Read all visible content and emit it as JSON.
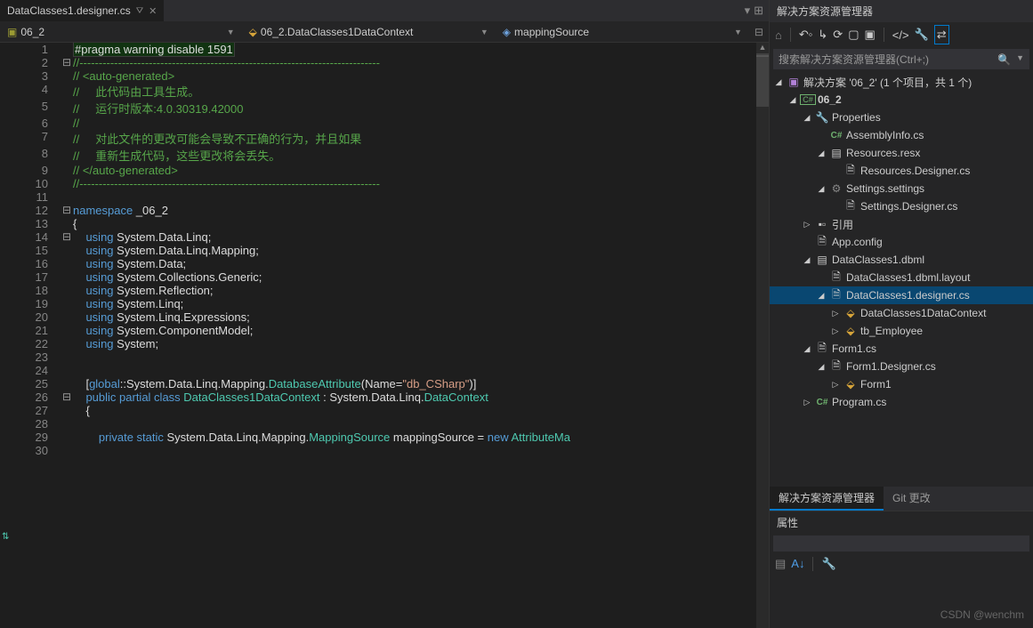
{
  "tab": {
    "title": "DataClasses1.designer.cs"
  },
  "nav": {
    "scope": "06_2",
    "class": "06_2.DataClasses1DataContext",
    "member": "mappingSource"
  },
  "code": {
    "lines": [
      {
        "n": 1,
        "fold": "",
        "segs": [
          [
            "hl",
            "#pragma warning disable 1591"
          ]
        ]
      },
      {
        "n": 2,
        "fold": "⊟",
        "segs": [
          [
            "comment",
            "//------------------------------------------------------------------------------"
          ]
        ]
      },
      {
        "n": 3,
        "fold": "",
        "segs": [
          [
            "comment",
            "// <auto-generated>"
          ]
        ]
      },
      {
        "n": 4,
        "fold": "",
        "segs": [
          [
            "comment",
            "//     此代码由工具生成。"
          ]
        ]
      },
      {
        "n": 5,
        "fold": "",
        "segs": [
          [
            "comment",
            "//     运行时版本:4.0.30319.42000"
          ]
        ]
      },
      {
        "n": 6,
        "fold": "",
        "segs": [
          [
            "comment",
            "//"
          ]
        ]
      },
      {
        "n": 7,
        "fold": "",
        "segs": [
          [
            "comment",
            "//     对此文件的更改可能会导致不正确的行为，并且如果"
          ]
        ]
      },
      {
        "n": 8,
        "fold": "",
        "segs": [
          [
            "comment",
            "//     重新生成代码，这些更改将会丢失。"
          ]
        ]
      },
      {
        "n": 9,
        "fold": "",
        "segs": [
          [
            "comment",
            "// </auto-generated>"
          ]
        ]
      },
      {
        "n": 10,
        "fold": "",
        "segs": [
          [
            "comment",
            "//------------------------------------------------------------------------------"
          ]
        ]
      },
      {
        "n": 11,
        "fold": "",
        "segs": [
          [
            "default",
            ""
          ]
        ]
      },
      {
        "n": 12,
        "fold": "⊟",
        "segs": [
          [
            "keyword",
            "namespace"
          ],
          [
            "default",
            " _06_2"
          ]
        ]
      },
      {
        "n": 13,
        "fold": "",
        "segs": [
          [
            "default",
            "{"
          ]
        ]
      },
      {
        "n": 14,
        "fold": "⊟",
        "segs": [
          [
            "default",
            "    "
          ],
          [
            "keyword",
            "using"
          ],
          [
            "default",
            " System.Data.Linq;"
          ]
        ]
      },
      {
        "n": 15,
        "fold": "",
        "segs": [
          [
            "default",
            "    "
          ],
          [
            "keyword",
            "using"
          ],
          [
            "default",
            " System.Data.Linq.Mapping;"
          ]
        ]
      },
      {
        "n": 16,
        "fold": "",
        "segs": [
          [
            "default",
            "    "
          ],
          [
            "keyword",
            "using"
          ],
          [
            "default",
            " System.Data;"
          ]
        ]
      },
      {
        "n": 17,
        "fold": "",
        "segs": [
          [
            "default",
            "    "
          ],
          [
            "keyword",
            "using"
          ],
          [
            "default",
            " System.Collections.Generic;"
          ]
        ]
      },
      {
        "n": 18,
        "fold": "",
        "segs": [
          [
            "default",
            "    "
          ],
          [
            "keyword",
            "using"
          ],
          [
            "default",
            " System.Reflection;"
          ]
        ]
      },
      {
        "n": 19,
        "fold": "",
        "segs": [
          [
            "default",
            "    "
          ],
          [
            "keyword",
            "using"
          ],
          [
            "default",
            " System.Linq;"
          ]
        ]
      },
      {
        "n": 20,
        "fold": "",
        "segs": [
          [
            "default",
            "    "
          ],
          [
            "keyword",
            "using"
          ],
          [
            "default",
            " System.Linq.Expressions;"
          ]
        ]
      },
      {
        "n": 21,
        "fold": "",
        "segs": [
          [
            "default",
            "    "
          ],
          [
            "keyword",
            "using"
          ],
          [
            "default",
            " System.ComponentModel;"
          ]
        ]
      },
      {
        "n": 22,
        "fold": "",
        "segs": [
          [
            "default",
            "    "
          ],
          [
            "keyword",
            "using"
          ],
          [
            "default",
            " System;"
          ]
        ]
      },
      {
        "n": 23,
        "fold": "",
        "segs": [
          [
            "default",
            "    "
          ]
        ]
      },
      {
        "n": 24,
        "fold": "",
        "segs": [
          [
            "default",
            "    "
          ]
        ]
      },
      {
        "n": 25,
        "fold": "",
        "segs": [
          [
            "default",
            "    ["
          ],
          [
            "keyword",
            "global"
          ],
          [
            "default",
            "::System.Data.Linq.Mapping."
          ],
          [
            "type",
            "DatabaseAttribute"
          ],
          [
            "default",
            "(Name="
          ],
          [
            "string",
            "\"db_CSharp\""
          ],
          [
            "default",
            ")]"
          ]
        ]
      },
      {
        "n": 26,
        "fold": "⊟",
        "segs": [
          [
            "default",
            "    "
          ],
          [
            "keyword",
            "public partial class"
          ],
          [
            "default",
            " "
          ],
          [
            "type",
            "DataClasses1DataContext"
          ],
          [
            "default",
            " : System.Data.Linq."
          ],
          [
            "type",
            "DataContext"
          ]
        ]
      },
      {
        "n": 27,
        "fold": "",
        "segs": [
          [
            "default",
            "    {"
          ]
        ]
      },
      {
        "n": 28,
        "fold": "",
        "segs": [
          [
            "default",
            "        "
          ]
        ]
      },
      {
        "n": 29,
        "fold": "",
        "segs": [
          [
            "default",
            "        "
          ],
          [
            "keyword",
            "private static"
          ],
          [
            "default",
            " System.Data.Linq.Mapping."
          ],
          [
            "type",
            "MappingSource"
          ],
          [
            "default",
            " mappingSource = "
          ],
          [
            "keyword",
            "new"
          ],
          [
            "default",
            " "
          ],
          [
            "type",
            "AttributeMa"
          ]
        ]
      },
      {
        "n": 30,
        "fold": "",
        "segs": [
          [
            "default",
            "        "
          ]
        ]
      }
    ]
  },
  "solutionExplorer": {
    "title": "解决方案资源管理器",
    "searchPlaceholder": "搜索解决方案资源管理器(Ctrl+;)",
    "solution": "解决方案 '06_2' (1 个项目，共 1 个)",
    "tree": [
      {
        "depth": 0,
        "arrow": "◢",
        "icon": "solution",
        "label": "解决方案 '06_2' (1 个项目，共 1 个)"
      },
      {
        "depth": 1,
        "arrow": "◢",
        "icon": "csproj",
        "label": "06_2",
        "bold": true
      },
      {
        "depth": 2,
        "arrow": "◢",
        "icon": "wrench",
        "label": "Properties"
      },
      {
        "depth": 3,
        "arrow": "",
        "icon": "cs",
        "label": "AssemblyInfo.cs"
      },
      {
        "depth": 3,
        "arrow": "◢",
        "icon": "resx",
        "label": "Resources.resx"
      },
      {
        "depth": 4,
        "arrow": "",
        "icon": "cs-gen",
        "label": "Resources.Designer.cs"
      },
      {
        "depth": 3,
        "arrow": "◢",
        "icon": "settings",
        "label": "Settings.settings"
      },
      {
        "depth": 4,
        "arrow": "",
        "icon": "cs-gen",
        "label": "Settings.Designer.cs"
      },
      {
        "depth": 2,
        "arrow": "▷",
        "icon": "refs",
        "label": "引用"
      },
      {
        "depth": 2,
        "arrow": "",
        "icon": "config",
        "label": "App.config"
      },
      {
        "depth": 2,
        "arrow": "◢",
        "icon": "dbml",
        "label": "DataClasses1.dbml"
      },
      {
        "depth": 3,
        "arrow": "",
        "icon": "layout",
        "label": "DataClasses1.dbml.layout"
      },
      {
        "depth": 3,
        "arrow": "◢",
        "icon": "cs-gen",
        "label": "DataClasses1.designer.cs",
        "selected": true
      },
      {
        "depth": 4,
        "arrow": "▷",
        "icon": "class",
        "label": "DataClasses1DataContext"
      },
      {
        "depth": 4,
        "arrow": "▷",
        "icon": "class",
        "label": "tb_Employee"
      },
      {
        "depth": 2,
        "arrow": "◢",
        "icon": "cs-gen",
        "label": "Form1.cs"
      },
      {
        "depth": 3,
        "arrow": "◢",
        "icon": "cs-gen",
        "label": "Form1.Designer.cs"
      },
      {
        "depth": 4,
        "arrow": "▷",
        "icon": "class",
        "label": "Form1"
      },
      {
        "depth": 2,
        "arrow": "▷",
        "icon": "cs",
        "label": "Program.cs"
      }
    ],
    "bottomTabs": {
      "active": "解决方案资源管理器",
      "other": "Git 更改"
    }
  },
  "properties": {
    "title": "属性"
  },
  "watermark": "CSDN @wenchm"
}
